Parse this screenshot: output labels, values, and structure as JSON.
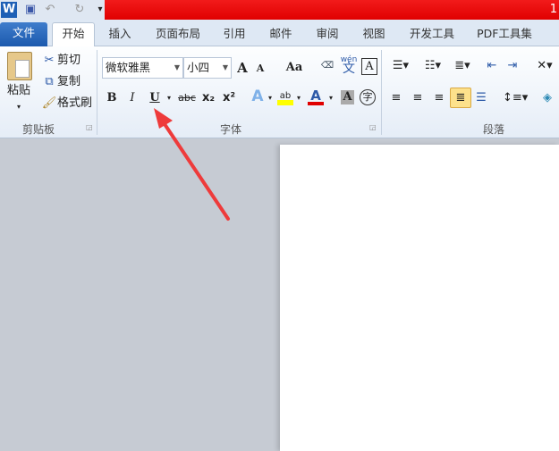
{
  "titlebar": {
    "title_fragment": "1",
    "quick_access": [
      "word-icon",
      "save-icon",
      "undo-icon",
      "redo-icon",
      "customize-icon"
    ]
  },
  "tabs": [
    "文件",
    "开始",
    "插入",
    "页面布局",
    "引用",
    "邮件",
    "审阅",
    "视图",
    "开发工具",
    "PDF工具集"
  ],
  "clipboard": {
    "paste": "粘贴",
    "cut": "剪切",
    "copy": "复制",
    "format_painter": "格式刷",
    "label": "剪贴板"
  },
  "font": {
    "name": "微软雅黑",
    "size": "小四",
    "label": "字体",
    "bold": "B",
    "italic": "I",
    "underline": "U",
    "strike": "abc",
    "sub": "x₂",
    "sup": "x²",
    "case": "Aa",
    "grow": "A",
    "shrink": "A",
    "pinyin": "wén",
    "char_border": "A",
    "text_effect": "A",
    "highlight": "ab",
    "font_color": "A",
    "char_shading": "A",
    "enclose": "字"
  },
  "paragraph": {
    "label": "段落"
  },
  "colors": {
    "accent_red": "#e00000",
    "highlight": "#ffff00",
    "font_color": "#e00000"
  }
}
